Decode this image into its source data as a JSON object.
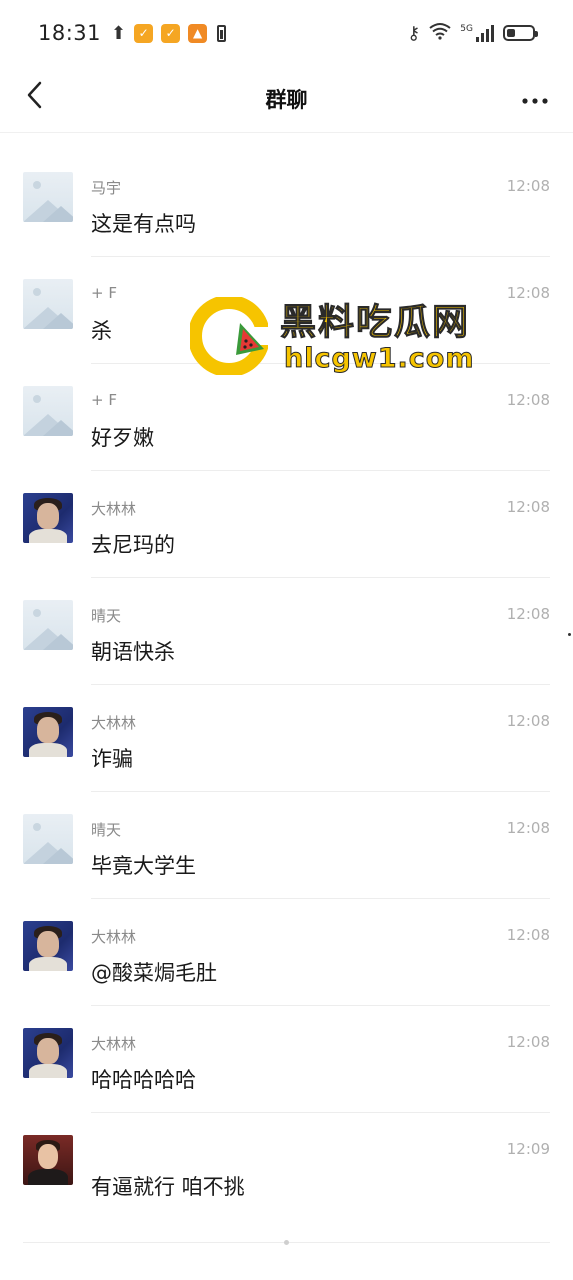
{
  "status_bar": {
    "time": "18:31",
    "network_label": "5G",
    "icons": [
      "upload-icon",
      "app-badge-icon",
      "app-badge-icon",
      "app-badge-icon",
      "battery-saver-icon",
      "key-icon",
      "wifi-icon",
      "signal-icon",
      "battery-icon"
    ]
  },
  "nav": {
    "title": "群聊",
    "back_icon": "chevron-left-icon",
    "more_icon": "more-horizontal-icon"
  },
  "messages": [
    {
      "sender": "马宇",
      "text": "这是有点吗",
      "time": "12:08",
      "avatar": "placeholder"
    },
    {
      "sender": "+ F",
      "text": "杀",
      "time": "12:08",
      "avatar": "placeholder"
    },
    {
      "sender": "+ F",
      "text": "好歹嫩",
      "time": "12:08",
      "avatar": "placeholder"
    },
    {
      "sender": "大林林",
      "text": "去尼玛的",
      "time": "12:08",
      "avatar": "person"
    },
    {
      "sender": "晴天",
      "text": "朝语快杀",
      "time": "12:08",
      "avatar": "placeholder"
    },
    {
      "sender": "大林林",
      "text": "诈骗",
      "time": "12:08",
      "avatar": "person"
    },
    {
      "sender": "晴天",
      "text": "毕竟大学生",
      "time": "12:08",
      "avatar": "placeholder"
    },
    {
      "sender": "大林林",
      "text": "@酸菜焗毛肚",
      "time": "12:08",
      "avatar": "person"
    },
    {
      "sender": "大林林",
      "text": "哈哈哈哈哈",
      "time": "12:08",
      "avatar": "person"
    },
    {
      "sender": "",
      "text": "有逼就行 咱不挑",
      "time": "12:09",
      "avatar": "portrait"
    }
  ],
  "watermark": {
    "title": "黑料吃瓜网",
    "url": "hlcgw1.com"
  }
}
